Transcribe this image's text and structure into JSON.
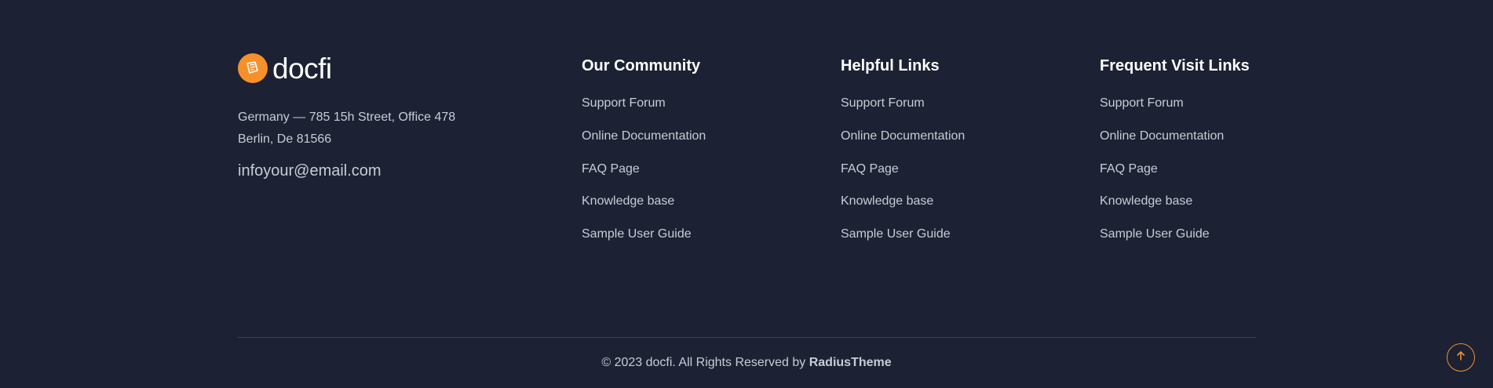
{
  "brand": {
    "logo_text": "docfi",
    "address_line1": "Germany — 785 15h Street, Office 478",
    "address_line2": "Berlin, De 81566",
    "email": "infoyour@email.com",
    "accent_color": "#f5902a"
  },
  "columns": [
    {
      "title": "Our Community",
      "links": [
        "Support Forum",
        "Online Documentation",
        "FAQ Page",
        "Knowledge base",
        "Sample User Guide"
      ]
    },
    {
      "title": "Helpful Links",
      "links": [
        "Support Forum",
        "Online Documentation",
        "FAQ Page",
        "Knowledge base",
        "Sample User Guide"
      ]
    },
    {
      "title": "Frequent Visit Links",
      "links": [
        "Support Forum",
        "Online Documentation",
        "FAQ Page",
        "Knowledge base",
        "Sample User Guide"
      ]
    }
  ],
  "copyright": {
    "text": "© 2023 docfi. All Rights Reserved by ",
    "author": "RadiusTheme"
  },
  "scroll_top_icon": "arrow-up-icon"
}
